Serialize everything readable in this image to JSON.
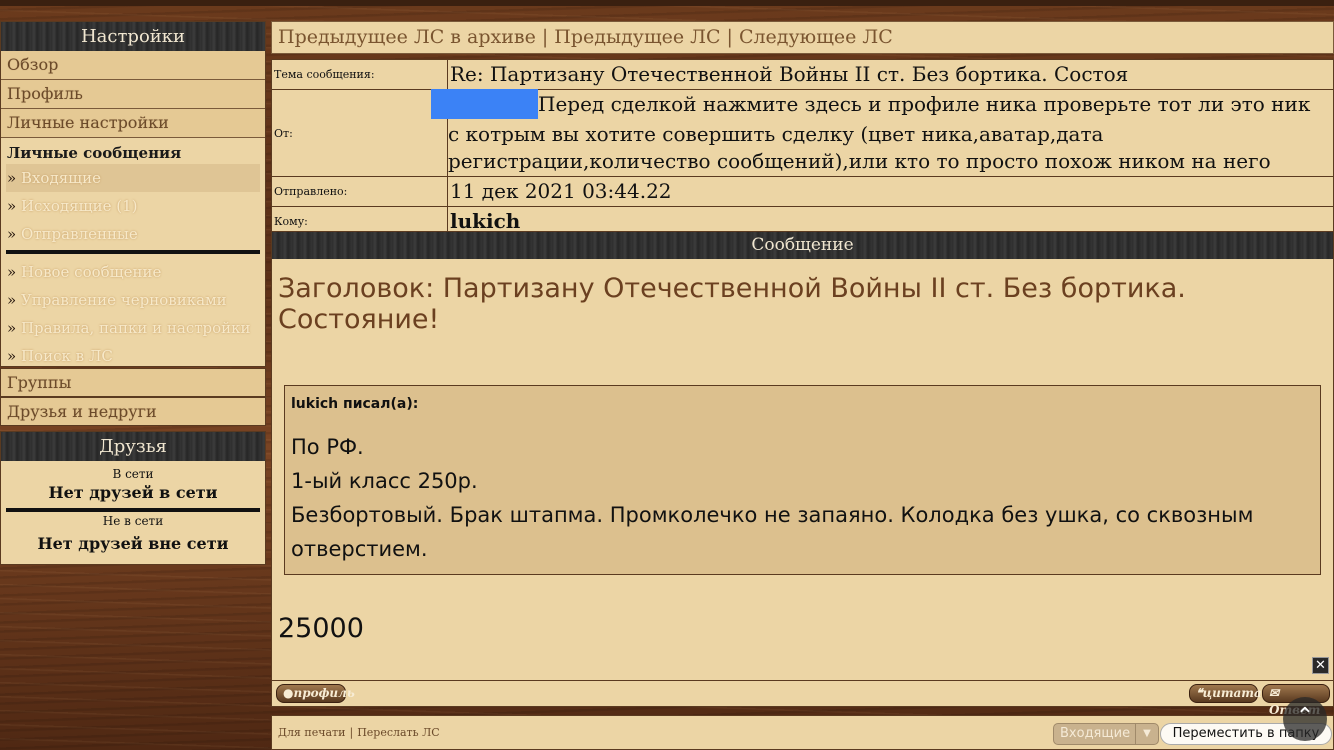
{
  "sidebar": {
    "title": "Настройки",
    "sections": [
      "Обзор",
      "Профиль",
      "Личные настройки"
    ],
    "pm_title": "Личные сообщения",
    "pm_items": [
      "Входящие",
      "Исходящие (1)",
      "Отправленные"
    ],
    "pm_actions": [
      "Новое сообщение",
      "Управление черновиками",
      "Правила, папки и настройки",
      "Поиск в ЛС"
    ],
    "bottom_sections": [
      "Группы",
      "Друзья и недруги"
    ]
  },
  "friends": {
    "title": "Друзья",
    "online_label": "В сети",
    "online_text": "Нет друзей в сети",
    "offline_label": "Не в сети",
    "offline_text": "Нет друзей вне сети"
  },
  "nav": {
    "prev_archive": "Предыдущее ЛС в архиве",
    "prev": "Предыдущее ЛС",
    "next": "Следующее ЛС",
    "separator": "|"
  },
  "meta": {
    "subject_label": "Тема сообщения:",
    "subject": "Re: Партизану Отечественной Войны II ст. Без бортика. Состоя",
    "from_label": "От:",
    "from_notice": "Перед сделкой нажмите здесь и профиле ника проверьте тот ли это ник с котрым вы хотите совершить сделку (цвет ника,аватар,дата регистрации,количество сообщений),или кто то просто похож ником на него",
    "sent_label": "Отправлено:",
    "sent": "11 дек 2021 03:44.22",
    "to_label": "Кому:",
    "to": "lukich"
  },
  "message": {
    "header": "Сообщение",
    "subject": "Заголовок: Партизану Отечественной Войны II ст. Без бортика. Состояние!",
    "quote_author": "lukich писал(а):",
    "quote_lines": [
      "По РФ.",
      "1-ый класс 250р.",
      "Безбортовый. Брак штапма. Промколечко не запаяно. Колодка без ушка, со сквозным отверстием."
    ],
    "amount": "25000"
  },
  "actions": {
    "profile": "профиль",
    "quote": "цитата",
    "reply": "Ответ",
    "close": "✕"
  },
  "footer": {
    "print": "Для печати",
    "forward": "Переслать ЛС",
    "folder_selected": "Входящие",
    "move_button": "Переместить в папку"
  },
  "colors": {
    "panel": "#ecd5a5",
    "accent_green": "#3f6b1a",
    "redact_blue": "#3b82f6"
  }
}
